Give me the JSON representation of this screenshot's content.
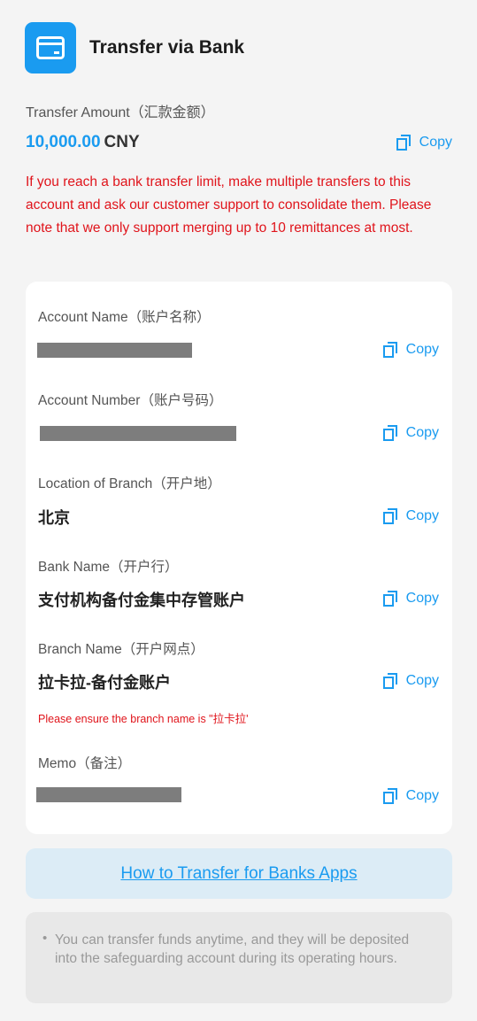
{
  "header": {
    "title": "Transfer via Bank",
    "icon": "bank-card-icon",
    "accent_color": "#1a9bf0"
  },
  "amount": {
    "label": "Transfer Amount（汇款金额）",
    "value": "10,000.00",
    "currency": "CNY",
    "copy_label": "Copy"
  },
  "warning": "If you reach a bank transfer limit, make multiple transfers to this account and ask our customer support to consolidate them. Please note that we only support merging up to 10 remittances at most.",
  "fields": {
    "account_name": {
      "label": "Account Name（账户名称）",
      "value_redacted": true,
      "copy_label": "Copy"
    },
    "account_number": {
      "label": "Account Number（账户号码）",
      "value_redacted": true,
      "copy_label": "Copy"
    },
    "location": {
      "label": "Location of Branch（开户地）",
      "value": "北京",
      "copy_label": "Copy"
    },
    "bank_name": {
      "label": "Bank Name（开户行）",
      "value": "支付机构备付金集中存管账户",
      "copy_label": "Copy"
    },
    "branch_name": {
      "label": "Branch Name（开户网点）",
      "value": "拉卡拉-备付金账户",
      "copy_label": "Copy",
      "note": "Please ensure the branch name is \"拉卡拉'"
    },
    "memo": {
      "label": "Memo（备注）",
      "value_redacted": true,
      "copy_label": "Copy"
    }
  },
  "howto_link": "How to Transfer for Banks Apps",
  "info_text": "You can transfer funds anytime, and they will be deposited into the safeguarding account during its operating hours.",
  "colors": {
    "warning": "#e0141b",
    "link": "#1a9bf0",
    "redacted": "#7d7d7d"
  }
}
